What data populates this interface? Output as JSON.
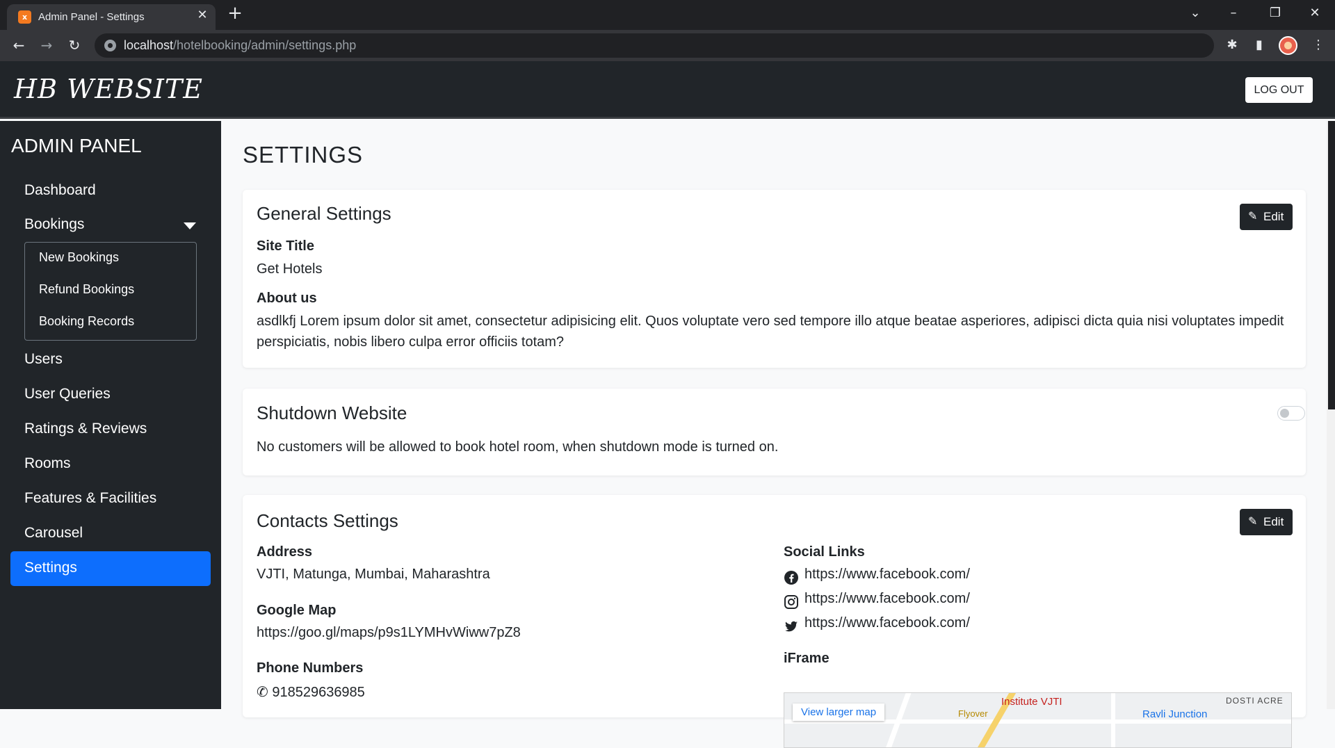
{
  "browser": {
    "tab_title": "Admin Panel - Settings",
    "favicon_text": "x",
    "url_host": "localhost",
    "url_path": "/hotelbooking/admin/settings.php"
  },
  "header": {
    "brand": "HB WEBSITE",
    "logout_label": "LOG OUT"
  },
  "sidebar": {
    "title": "ADMIN PANEL",
    "items": [
      {
        "label": "Dashboard"
      },
      {
        "label": "Bookings"
      },
      {
        "label": "Users"
      },
      {
        "label": "User Queries"
      },
      {
        "label": "Ratings & Reviews"
      },
      {
        "label": "Rooms"
      },
      {
        "label": "Features & Facilities"
      },
      {
        "label": "Carousel"
      },
      {
        "label": "Settings",
        "active": true
      }
    ],
    "booking_submenu": [
      {
        "label": "New Bookings"
      },
      {
        "label": "Refund Bookings"
      },
      {
        "label": "Booking Records"
      }
    ]
  },
  "page": {
    "title": "SETTINGS"
  },
  "general": {
    "title": "General Settings",
    "edit_label": "Edit",
    "site_title_label": "Site Title",
    "site_title_value": "Get Hotels",
    "about_label": "About us",
    "about_value": "asdlkfj Lorem ipsum dolor sit amet, consectetur adipisicing elit. Quos voluptate vero sed tempore illo atque beatae asperiores, adipisci dicta quia nisi voluptates impedit perspiciatis, nobis libero culpa error officiis totam?"
  },
  "shutdown": {
    "title": "Shutdown Website",
    "enabled": false,
    "description": "No customers will be allowed to book hotel room, when shutdown mode is turned on."
  },
  "contacts": {
    "title": "Contacts Settings",
    "edit_label": "Edit",
    "address_label": "Address",
    "address_value": "VJTI, Matunga, Mumbai, Maharashtra",
    "map_label": "Google Map",
    "map_value": "https://goo.gl/maps/p9s1LYMHvWiww7pZ8",
    "phone_label": "Phone Numbers",
    "phone_value": "918529636985",
    "social_label": "Social Links",
    "social_links": [
      {
        "icon": "facebook-icon",
        "url": "https://www.facebook.com/"
      },
      {
        "icon": "instagram-icon",
        "url": "https://www.facebook.com/"
      },
      {
        "icon": "twitter-icon",
        "url": "https://www.facebook.com/"
      }
    ],
    "iframe_label": "iFrame",
    "iframe_map": {
      "view_larger": "View larger map",
      "place_1": "Institute VJTI",
      "place_2": "Ravli Junction",
      "place_3": "DOSTI ACRE",
      "place_4": "Flyover"
    }
  },
  "colors": {
    "dark": "#212529",
    "primary": "#0d6efd",
    "page_bg": "#f8f9fa"
  }
}
